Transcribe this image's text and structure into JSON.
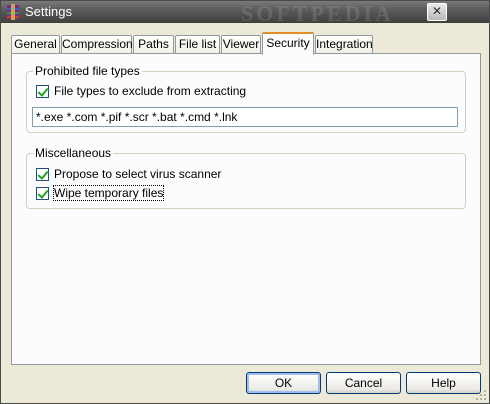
{
  "window": {
    "title": "Settings",
    "watermark": "SOFTPEDIA",
    "close_glyph": "✕"
  },
  "tabs": [
    {
      "label": "General"
    },
    {
      "label": "Compression"
    },
    {
      "label": "Paths"
    },
    {
      "label": "File list"
    },
    {
      "label": "Viewer"
    },
    {
      "label": "Security",
      "active": true
    },
    {
      "label": "Integration"
    }
  ],
  "prohibited": {
    "title": "Prohibited file types",
    "checkbox_label": "File types to exclude from extracting",
    "checked": true,
    "value": "*.exe *.com *.pif *.scr *.bat *.cmd *.lnk"
  },
  "misc": {
    "title": "Miscellaneous",
    "items": [
      {
        "label": "Propose to select virus scanner",
        "checked": true
      },
      {
        "label": "Wipe temporary files",
        "checked": true
      }
    ]
  },
  "buttons": {
    "ok": "OK",
    "cancel": "Cancel",
    "help": "Help"
  },
  "colors": {
    "accent_tab": "#e68b2c",
    "check": "#21a121"
  }
}
